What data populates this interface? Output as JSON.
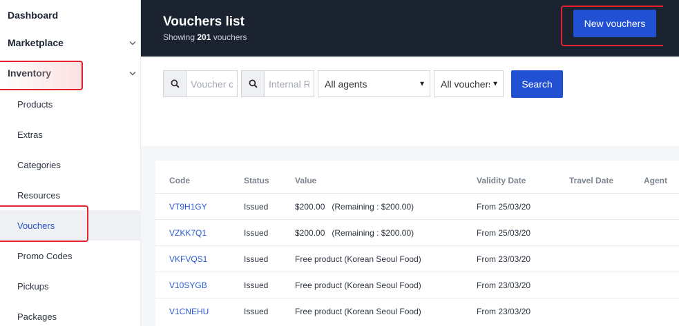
{
  "sidebar": {
    "top_items": [
      {
        "label": "Dashboard",
        "expandable": false
      },
      {
        "label": "Marketplace",
        "expandable": true
      },
      {
        "label": "Inventory",
        "expandable": true
      }
    ],
    "sub_items": [
      {
        "label": "Products",
        "active": false
      },
      {
        "label": "Extras",
        "active": false
      },
      {
        "label": "Categories",
        "active": false
      },
      {
        "label": "Resources",
        "active": false
      },
      {
        "label": "Vouchers",
        "active": true
      },
      {
        "label": "Promo Codes",
        "active": false
      },
      {
        "label": "Pickups",
        "active": false
      },
      {
        "label": "Packages",
        "active": false
      }
    ]
  },
  "header": {
    "title": "Vouchers list",
    "subtitle_prefix": "Showing",
    "count": "201",
    "subtitle_suffix": "vouchers",
    "new_button": "New vouchers"
  },
  "filters": {
    "voucher_code_placeholder": "Voucher code",
    "internal_ref_placeholder": "Internal Reference",
    "agent_select": "All agents",
    "voucher_select": "All vouchers",
    "search_button": "Search"
  },
  "table": {
    "columns": [
      "Code",
      "Status",
      "Value",
      "Validity Date",
      "Travel Date",
      "Agent"
    ],
    "rows": [
      {
        "code": "VT9H1GY",
        "status": "Issued",
        "value": "$200.00   (Remaining : $200.00)",
        "validity": "From 25/03/20",
        "travel": "",
        "agent": ""
      },
      {
        "code": "VZKK7Q1",
        "status": "Issued",
        "value": "$200.00   (Remaining : $200.00)",
        "validity": "From 25/03/20",
        "travel": "",
        "agent": ""
      },
      {
        "code": "VKFVQS1",
        "status": "Issued",
        "value": "Free product (Korean Seoul Food)",
        "validity": "From 23/03/20",
        "travel": "",
        "agent": ""
      },
      {
        "code": "V10SYGB",
        "status": "Issued",
        "value": "Free product (Korean Seoul Food)",
        "validity": "From 23/03/20",
        "travel": "",
        "agent": ""
      },
      {
        "code": "V1CNEHU",
        "status": "Issued",
        "value": "Free product (Korean Seoul Food)",
        "validity": "From 23/03/20",
        "travel": "",
        "agent": ""
      }
    ]
  },
  "colors": {
    "header_bg": "#1b2331",
    "accent": "#2150d2",
    "link": "#2a5bd7",
    "highlight": "#e2232d"
  },
  "icons": {
    "search": "search-icon",
    "chevron": "chevron-down-icon"
  }
}
